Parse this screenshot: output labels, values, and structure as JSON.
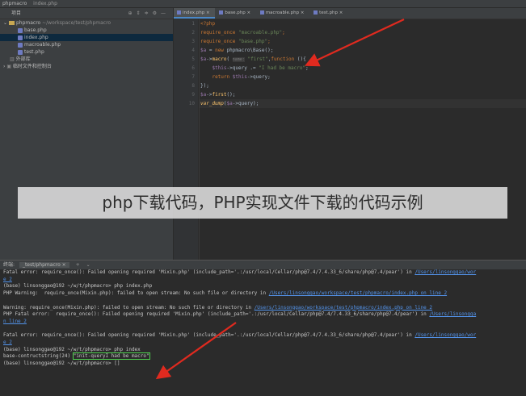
{
  "titlebar": {
    "project": "phpmacro",
    "file": "index.php"
  },
  "sidebar": {
    "title": "项目",
    "root": "phpmacro",
    "root_path": "~/workspace/test/phpmacro",
    "files": [
      "base.php",
      "index.php",
      "macroable.php",
      "test.php"
    ],
    "external": "外部库",
    "scratch": "临时文件和控制台"
  },
  "tabs": [
    "index.php",
    "base.php",
    "macroable.php",
    "test.php"
  ],
  "editor": {
    "line_numbers": [
      "1",
      "2",
      "3",
      "4",
      "5",
      "6",
      "7",
      "8",
      "9",
      "10"
    ],
    "hint": "name:"
  },
  "watermark": "php下载代码，PHP实现文件下载的代码示例",
  "terminal": {
    "title": "终端:",
    "tab": "_test/phpmacro",
    "lines": [
      {
        "parts": [
          {
            "t": "Fatal error: require_once(): Failed opening required 'Mixin.php' (include_path='.:/usr/local/Cellar/php@7.4/7.4.33_6/share/php@7.4/pear') in "
          },
          {
            "t": "/Users/linsonggao/wor",
            "c": "lnk"
          }
        ]
      },
      {
        "parts": [
          {
            "t": "e 2",
            "c": "lnk"
          }
        ]
      },
      {
        "parts": [
          {
            "t": "(base) linsonggao@192 ~/w/t/phpmacro> php index.php"
          }
        ]
      },
      {
        "parts": [
          {
            "t": "PHP Warning:  require_once(Mixin.php): failed to open stream: No such file or directory in "
          },
          {
            "t": "/Users/linsonggao/workspace/test/phpmacro/index.php on line 2",
            "c": "lnk"
          }
        ]
      },
      {
        "parts": [
          {
            "t": ""
          }
        ]
      },
      {
        "parts": [
          {
            "t": "Warning: require_once(Mixin.php): failed to open stream: No such file or directory in "
          },
          {
            "t": "/Users/linsonggao/workspace/test/phpmacro/index.php on line 2",
            "c": "lnk"
          }
        ]
      },
      {
        "parts": [
          {
            "t": "PHP Fatal error:  require_once(): Failed opening required 'Mixin.php' (include_path='.:/usr/local/Cellar/php@7.4/7.4.33_6/share/php@7.4/pear') in "
          },
          {
            "t": "/Users/linsongga",
            "c": "lnk"
          }
        ]
      },
      {
        "parts": [
          {
            "t": "n line 2",
            "c": "lnk"
          }
        ]
      },
      {
        "parts": [
          {
            "t": ""
          }
        ]
      },
      {
        "parts": [
          {
            "t": "Fatal error: require_once(): Failed opening required 'Mixin.php' (include_path='.:/usr/local/Cellar/php@7.4/7.4.33_6/share/php@7.4/pear') in "
          },
          {
            "t": "/Users/linsonggao/wor",
            "c": "lnk"
          }
        ]
      },
      {
        "parts": [
          {
            "t": "e 2",
            "c": "lnk"
          }
        ]
      },
      {
        "parts": [
          {
            "t": "(base) linsonggao@192 ~/w/t/phpmacro> php index"
          }
        ]
      },
      {
        "parts": [
          {
            "t": "base-contructstring(24) "
          },
          {
            "t": "\"init-queryI had be macro\"",
            "c": "boxed"
          }
        ]
      },
      {
        "parts": [
          {
            "t": "(base) linsonggao@192 ~/w/t/phpmacro> []"
          }
        ]
      }
    ]
  },
  "colors": {
    "arrow": "#e02a1f",
    "highlight": "#4fd14f",
    "link": "#5394ec"
  }
}
